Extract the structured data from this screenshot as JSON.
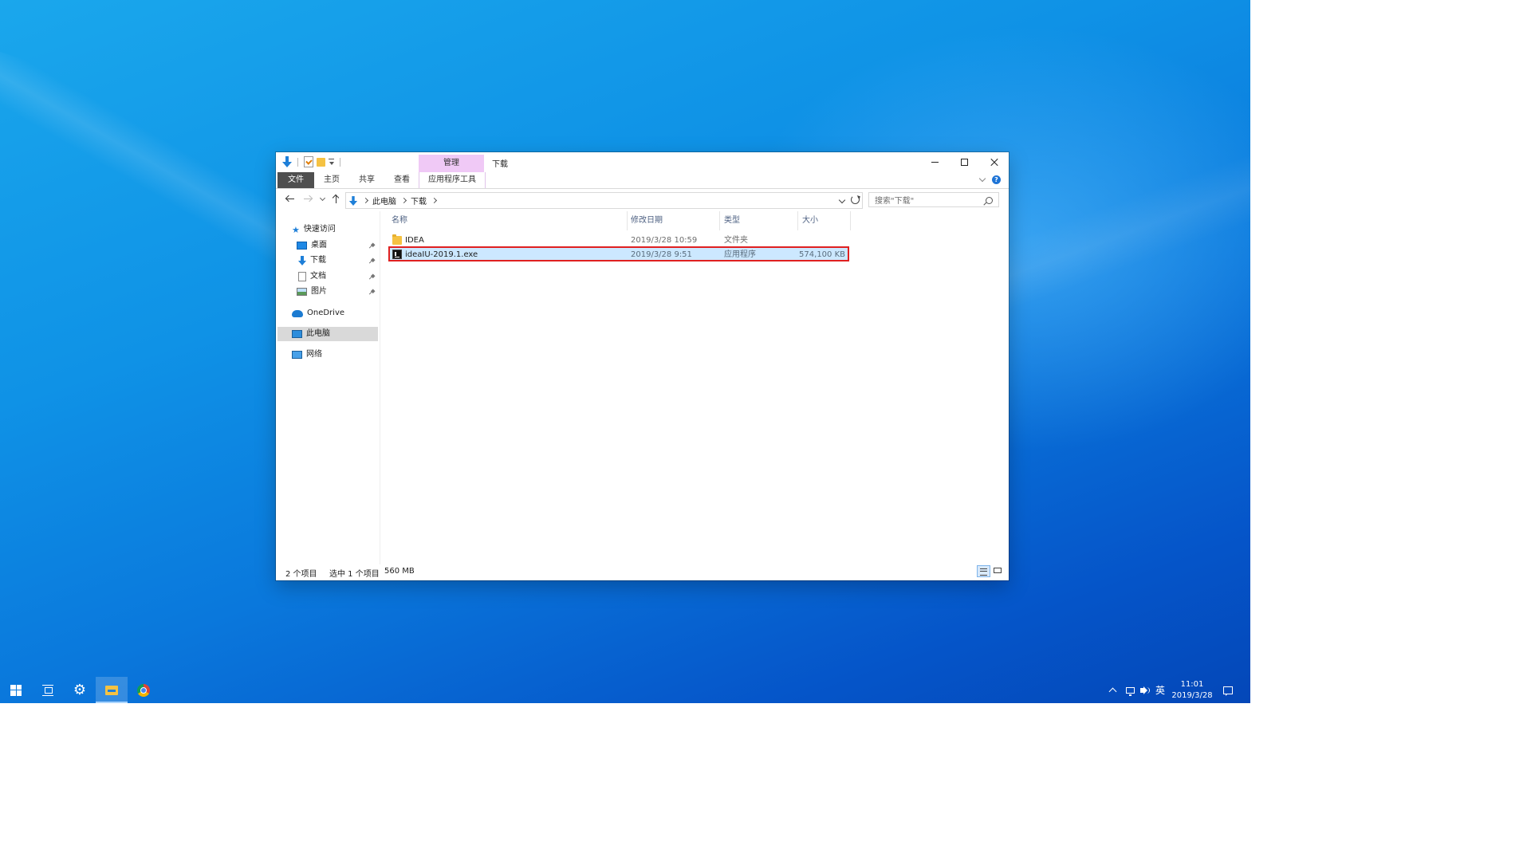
{
  "window": {
    "title": "下载",
    "context_tab_header": "管理"
  },
  "ribbon": {
    "tabs": [
      "文件",
      "主页",
      "共享",
      "查看"
    ],
    "context_tab": "应用程序工具"
  },
  "address": {
    "crumbs": [
      "此电脑",
      "下载"
    ]
  },
  "search": {
    "placeholder": "搜索\"下载\""
  },
  "nav_pane": {
    "quick_access": "快速访问",
    "quick_items": [
      "桌面",
      "下载",
      "文档",
      "图片"
    ],
    "onedrive": "OneDrive",
    "this_pc": "此电脑",
    "network": "网络"
  },
  "columns": {
    "name": "名称",
    "date": "修改日期",
    "type": "类型",
    "size": "大小"
  },
  "files": [
    {
      "name": "IDEA",
      "date": "2019/3/28 10:59",
      "type": "文件夹",
      "size": "",
      "icon": "folder-icon"
    },
    {
      "name": "ideaIU-2019.1.exe",
      "date": "2019/3/28 9:51",
      "type": "应用程序",
      "size": "574,100 KB",
      "icon": "intellij-icon"
    }
  ],
  "status": {
    "item_count": "2 个项目",
    "selection": "选中 1 个项目",
    "selection_size": "560 MB"
  },
  "taskbar": {
    "ime": "英",
    "time": "11:01",
    "date": "2019/3/28"
  },
  "colors": {
    "selection": "#cce8ff",
    "highlight_border": "#e02020",
    "context_tab": "#f0c9f6"
  }
}
